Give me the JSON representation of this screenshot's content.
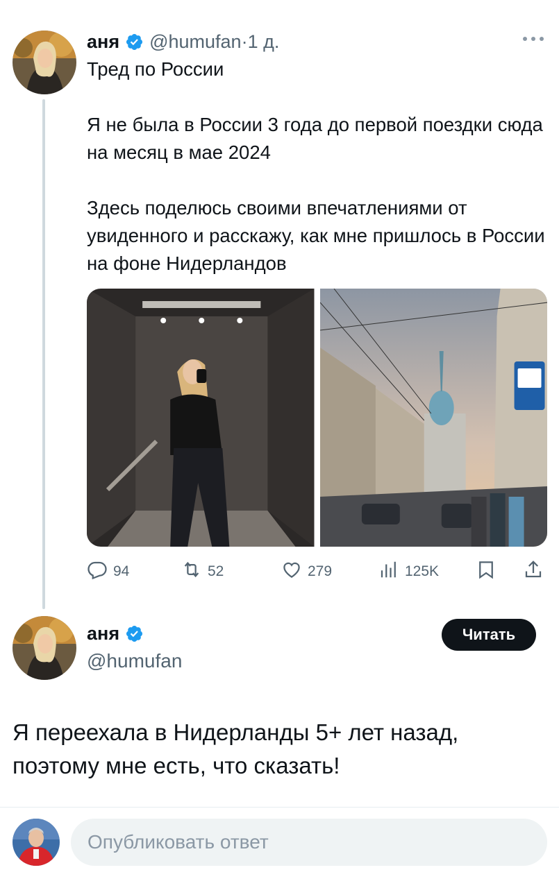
{
  "tweet1": {
    "author_name": "аня",
    "handle_time": "@humufan·1 д.",
    "text": "Тред по России\n\nЯ не была в России 3 года до первой поездки сюда на месяц в мае 2024\n\nЗдесь поделюсь своими впечатлениями от увиденного и расскажу, как мне пришлось в России на фоне Нидерландов",
    "stats": {
      "replies": "94",
      "retweets": "52",
      "likes": "279",
      "views": "125K"
    }
  },
  "tweet2": {
    "author_name": "аня",
    "handle": "@humufan",
    "follow_label": "Читать",
    "text": "Я переехала в Нидерланды 5+ лет назад, поэтому мне есть, что сказать!"
  },
  "reply": {
    "placeholder": "Опубликовать ответ"
  },
  "icons": [
    "verified-badge-icon",
    "more-icon",
    "reply-icon",
    "retweet-icon",
    "like-icon",
    "views-icon",
    "bookmark-icon",
    "share-icon"
  ],
  "colors": {
    "verified": "#1d9bf0",
    "text": "#0f1419",
    "muted": "#536471",
    "button": "#0f1419"
  }
}
